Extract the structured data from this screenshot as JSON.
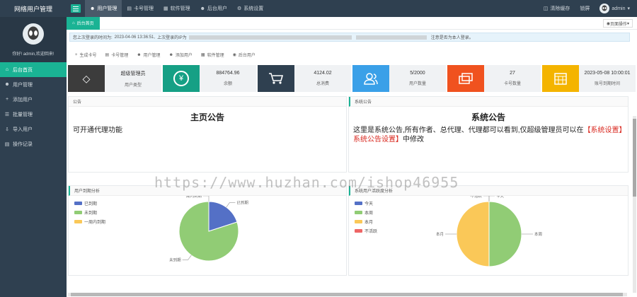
{
  "app": {
    "title": "网络用户管理"
  },
  "topnav": [
    {
      "label": "用户管理",
      "icon": "user-icon",
      "active": true
    },
    {
      "label": "卡号管理",
      "icon": "card-icon",
      "active": false
    },
    {
      "label": "软件管理",
      "icon": "grid-icon",
      "active": false
    },
    {
      "label": "后台用户",
      "icon": "user-icon",
      "active": false
    },
    {
      "label": "系统设置",
      "icon": "gear-icon",
      "active": false
    }
  ],
  "topright": {
    "clear_cache": "清除缓存",
    "lock": "锁屏",
    "user": "admin"
  },
  "sidebar": {
    "greeting": "你好! admin,欢迎回来!",
    "items": [
      {
        "label": "后台首页",
        "active": true
      },
      {
        "label": "用户管理",
        "active": false
      },
      {
        "label": "添加用户",
        "active": false
      },
      {
        "label": "批量管理",
        "active": false
      },
      {
        "label": "导入用户",
        "active": false
      },
      {
        "label": "操作记录",
        "active": false
      }
    ]
  },
  "tabs": {
    "home": "后台首页",
    "ops": "页面操作"
  },
  "notice": {
    "prefix": "您上次登录的时间为:",
    "time": "2023-04-06 13:36:51,",
    "ip_label": "上次登录的IP为",
    "suffix": "注意是否为本人登录。"
  },
  "quicklinks": [
    "生成卡号",
    "卡号管理",
    "用户管理",
    "添加用户",
    "软件管理",
    "后台用户"
  ],
  "cards": [
    {
      "value": "超级管理员",
      "label": "用户类型",
      "color": "#3c3c3c",
      "icon": "diamond-icon"
    },
    {
      "value": "884764.96",
      "label": "余额",
      "color": "#16a085",
      "icon": "yen-icon"
    },
    {
      "value": "4124.02",
      "label": "总消费",
      "color": "#2f4050",
      "icon": "cart-icon"
    },
    {
      "value": "5/2000",
      "label": "用户数量",
      "color": "#3aa0e8",
      "icon": "users-icon"
    },
    {
      "value": "27",
      "label": "卡号数量",
      "color": "#f0521f",
      "icon": "card-icon"
    },
    {
      "value": "2023-05-08 10:00:01",
      "label": "账号到期时间",
      "color": "#f4b400",
      "icon": "calendar-icon"
    }
  ],
  "announce_left": {
    "header": "公告",
    "title": "主页公告",
    "body": "可开通代理功能"
  },
  "announce_right": {
    "header": "系统公告",
    "title": "系统公告",
    "body_a": "这里是系统公告,所有作者、总代理、代理都可以看到,仅超级管理员可以在",
    "body_red": "【系统设置】系统公告设置】",
    "body_b": "中修改"
  },
  "chart_left": {
    "header": "用户到期分析",
    "legend": [
      {
        "name": "已到期",
        "color": "#5470c6"
      },
      {
        "name": "未到期",
        "color": "#91cc75"
      },
      {
        "name": "一周内到期",
        "color": "#fac858"
      }
    ]
  },
  "chart_right": {
    "header": "系统用户活跃度分析",
    "legend": [
      {
        "name": "今天",
        "color": "#5470c6"
      },
      {
        "name": "本周",
        "color": "#91cc75"
      },
      {
        "name": "本月",
        "color": "#fac858"
      },
      {
        "name": "不活跃",
        "color": "#ee6666"
      }
    ]
  },
  "chart_data": [
    {
      "type": "pie",
      "title": "用户到期分析",
      "categories": [
        "已到期",
        "未到期",
        "一周内到期"
      ],
      "values": [
        20,
        80,
        0
      ],
      "colors": [
        "#5470c6",
        "#91cc75",
        "#fac858"
      ]
    },
    {
      "type": "pie",
      "title": "系统用户活跃度分析",
      "categories": [
        "今天",
        "本周",
        "本月",
        "不活跃"
      ],
      "values": [
        0,
        50,
        50,
        0
      ],
      "colors": [
        "#5470c6",
        "#91cc75",
        "#fac858",
        "#ee6666"
      ]
    }
  ],
  "watermark": "https://www.huzhan.com/ishop46955"
}
